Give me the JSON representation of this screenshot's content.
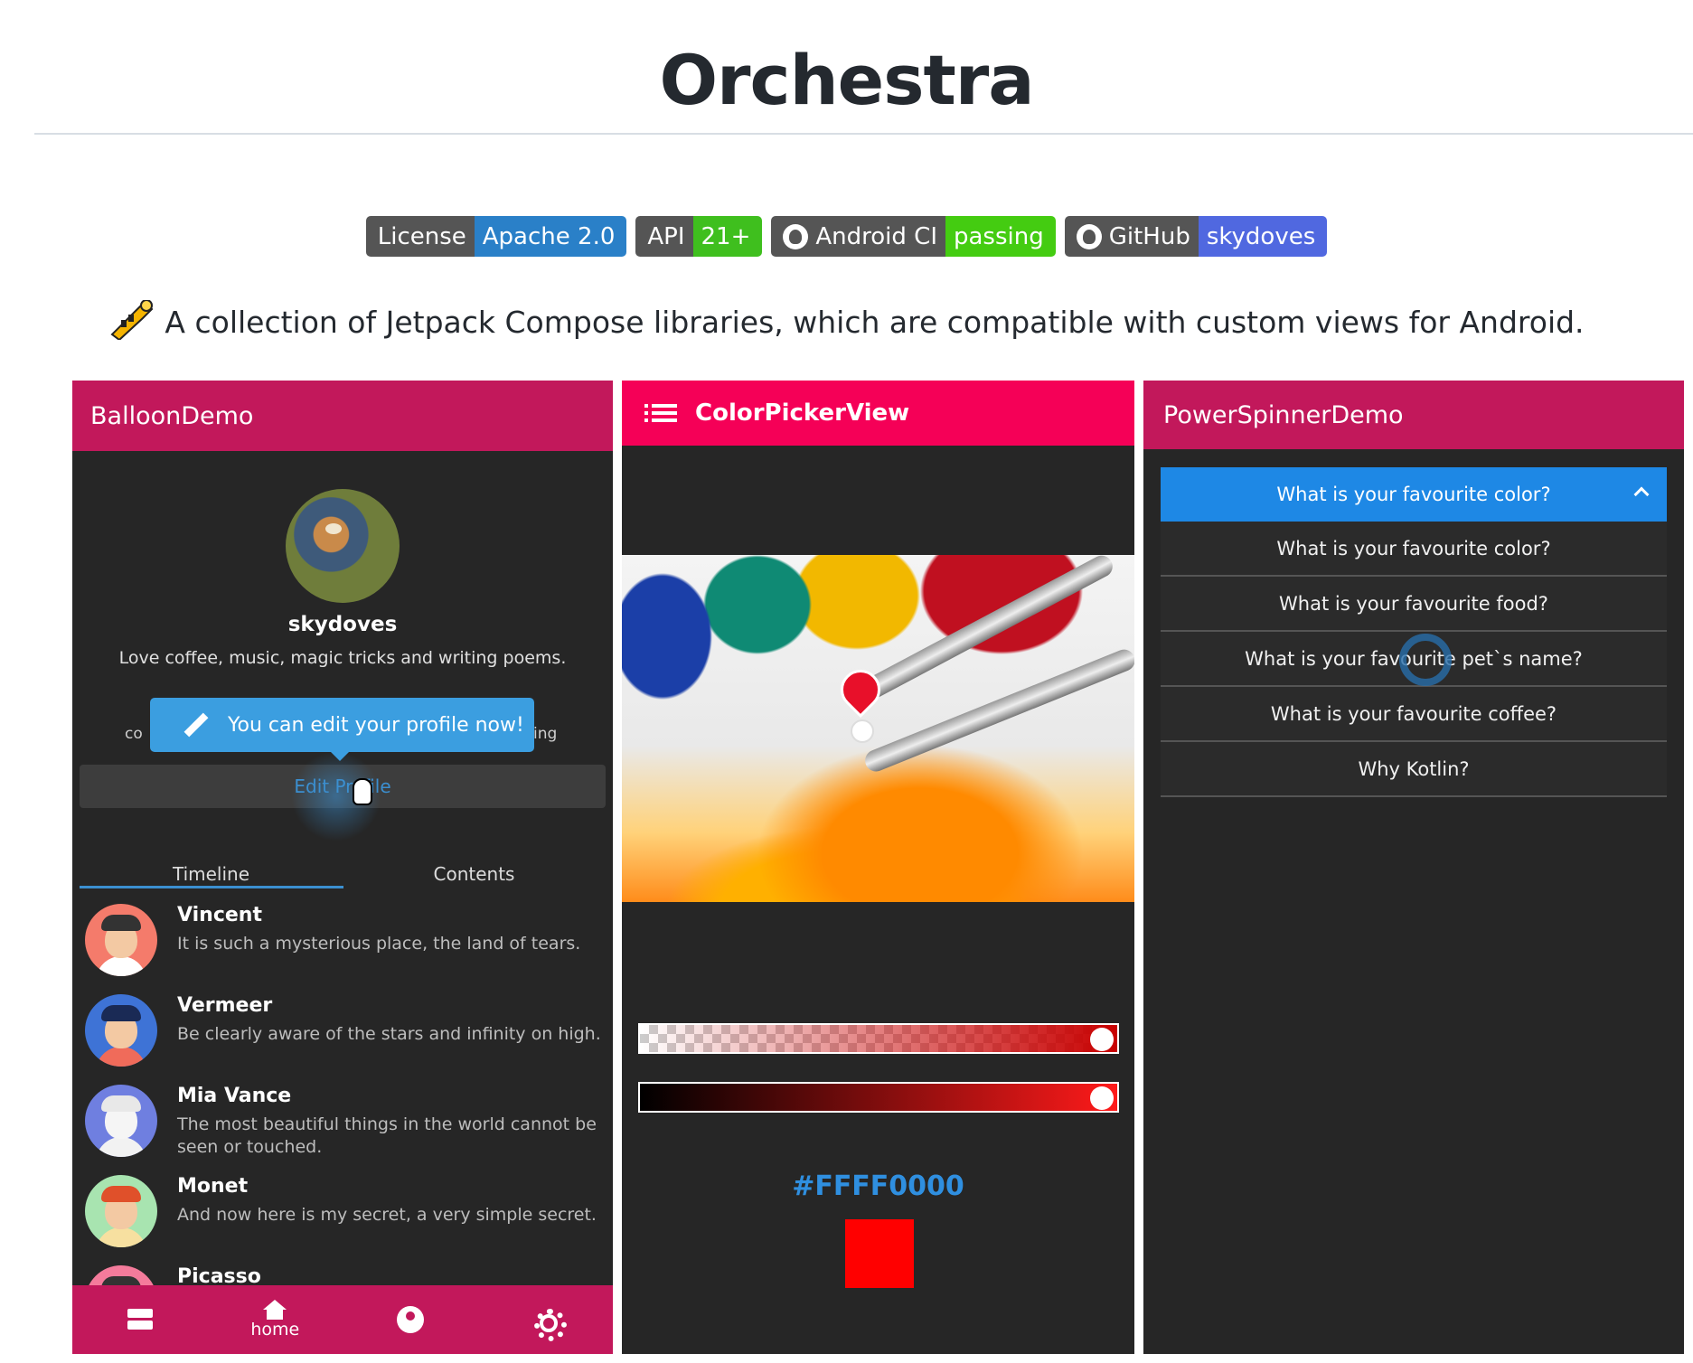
{
  "page": {
    "title": "Orchestra",
    "tagline": "A collection of Jetpack Compose libraries, which are compatible with custom views for Android."
  },
  "badges": [
    {
      "label": "License",
      "value": "Apache 2.0",
      "color": "#2a80c8"
    },
    {
      "label": "API",
      "value": "21+",
      "color": "#3fbf1e"
    },
    {
      "label": "Android CI",
      "value": "passing",
      "color": "#44cc11"
    },
    {
      "label": "GitHub",
      "value": "skydoves",
      "color": "#5068e0"
    }
  ],
  "balloon_demo": {
    "title": "BalloonDemo",
    "username": "skydoves",
    "bio": "Love coffee, music, magic tricks and writing poems.",
    "side_left": "co",
    "side_right": "ing",
    "balloon_text": "You can edit your profile now!",
    "edit_button": "Edit Profile",
    "tabs": [
      "Timeline",
      "Contents"
    ],
    "timeline": [
      {
        "name": "Vincent",
        "text": "It is such a mysterious place, the land of tears."
      },
      {
        "name": "Vermeer",
        "text": "Be clearly aware of the stars and infinity on high."
      },
      {
        "name": "Mia Vance",
        "text": "The most beautiful things in the world cannot be seen or touched."
      },
      {
        "name": "Monet",
        "text": "And now here is my secret, a very simple secret."
      },
      {
        "name": "Picasso",
        "text": ""
      }
    ],
    "bottom_nav": [
      {
        "icon": "server-icon",
        "label": ""
      },
      {
        "icon": "home-icon",
        "label": "home"
      },
      {
        "icon": "account-icon",
        "label": ""
      },
      {
        "icon": "settings-icon",
        "label": ""
      }
    ],
    "colors": {
      "primary": "#c2185b",
      "background": "#262626",
      "accent": "#3b8fd0"
    }
  },
  "color_picker": {
    "title": "ColorPickerView",
    "hex": "#FFFF0000",
    "selected_color": "#ff0000",
    "colors": {
      "primary": "#f50057"
    }
  },
  "power_spinner": {
    "title": "PowerSpinnerDemo",
    "selected": "What is your favourite color?",
    "items": [
      "What is your favourite color?",
      "What is your favourite food?",
      "What is your favourite pet`s name?",
      "What is your favourite coffee?",
      "Why Kotlin?"
    ],
    "colors": {
      "header": "#1e88e5"
    }
  }
}
